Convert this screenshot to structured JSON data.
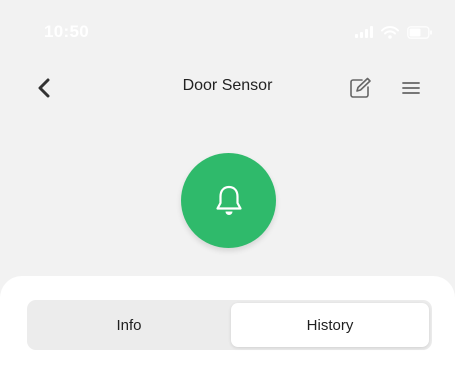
{
  "status_bar": {
    "time": "10:50"
  },
  "header": {
    "title": "Door Sensor",
    "back_icon": "chevron-left-icon",
    "edit_icon": "edit-icon",
    "menu_icon": "menu-icon"
  },
  "alarm": {
    "icon": "bell-icon",
    "color": "#2fba6b"
  },
  "tabs": [
    {
      "label": "Info",
      "selected": false
    },
    {
      "label": "History",
      "selected": true
    }
  ],
  "colors": {
    "background": "#f2f2f2",
    "accent_green": "#2fba6b",
    "sheet": "#ffffff"
  }
}
